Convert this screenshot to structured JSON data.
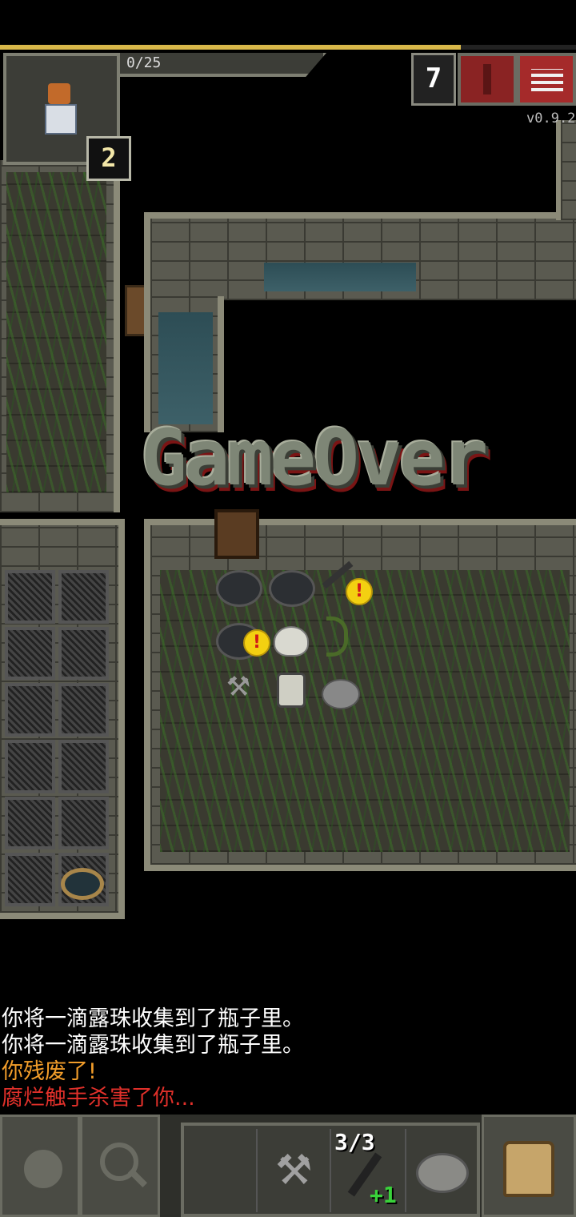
{
  "hud": {
    "experience": "0/25",
    "depth": "2",
    "danger_count": "7",
    "version": "v0.9.2",
    "xp_progress": 0.8,
    "colors": {
      "xp": "#d8b84a",
      "danger": "#a52a2a"
    }
  },
  "game_over": {
    "title": "GameOver"
  },
  "log": {
    "lines": [
      {
        "text": "你将一滴露珠收集到了瓶子里。",
        "color": "#ffffff"
      },
      {
        "text": "你将一滴露珠收集到了瓶子里。",
        "color": "#ffffff"
      },
      {
        "text": "你残废了!",
        "color": "#f29d2a"
      },
      {
        "text": "腐烂触手杀害了你...",
        "color": "#e0302a"
      }
    ]
  },
  "toolbar": {
    "wait_icon": "clock-icon",
    "search_icon": "magnifier-icon",
    "quickslot_pickaxe_icon": "pickaxe-icon",
    "quickslot_darts_count": "3/3",
    "quickslot_darts_bonus": "+1",
    "quickslot_stone_icon": "stone-icon",
    "backpack_icon": "backpack-icon"
  }
}
